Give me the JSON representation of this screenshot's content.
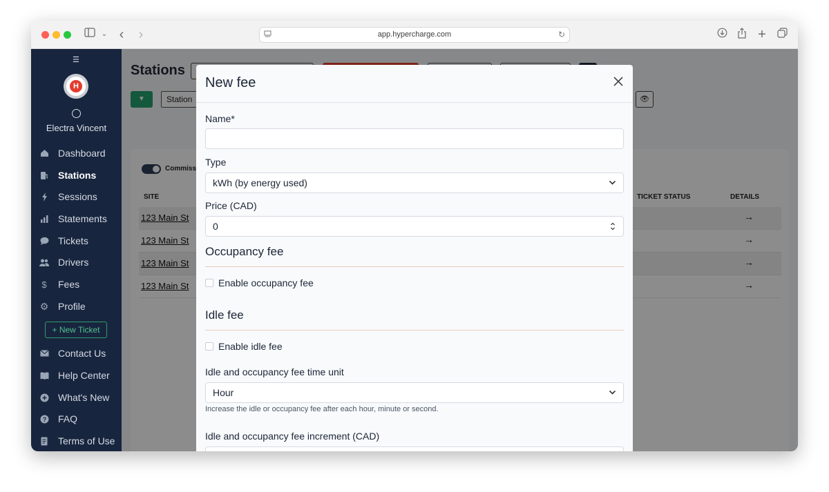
{
  "browser": {
    "url": "app.hypercharge.com"
  },
  "sidebar": {
    "user_name": "Electra Vincent",
    "logo_text": "H",
    "items": [
      {
        "label": "Dashboard",
        "icon": "home-icon"
      },
      {
        "label": "Stations",
        "icon": "charging-station-icon",
        "active": true
      },
      {
        "label": "Sessions",
        "icon": "bolt-icon"
      },
      {
        "label": "Statements",
        "icon": "bar-chart-icon"
      },
      {
        "label": "Tickets",
        "icon": "chat-bubble-icon"
      },
      {
        "label": "Drivers",
        "icon": "users-icon"
      },
      {
        "label": "Fees",
        "icon": "dollar-icon"
      },
      {
        "label": "Profile",
        "icon": "gear-icon"
      }
    ],
    "new_ticket_label": "New Ticket",
    "footer_items": [
      {
        "label": "Contact Us",
        "icon": "envelope-icon"
      },
      {
        "label": "Help Center",
        "icon": "book-icon"
      },
      {
        "label": "What's New",
        "icon": "plus-circle-icon"
      },
      {
        "label": "FAQ",
        "icon": "question-icon"
      },
      {
        "label": "Terms of Use",
        "icon": "document-icon"
      }
    ]
  },
  "page": {
    "title": "Stations",
    "station_filter": "Station",
    "toggle_label": "Commissi",
    "columns": {
      "site": "SITE",
      "ticket_status": "TICKET STATUS",
      "details": "DETAILS"
    },
    "rows": [
      {
        "site": "123 Main St"
      },
      {
        "site": "123 Main St"
      },
      {
        "site": "123 Main St"
      },
      {
        "site": "123 Main St"
      }
    ]
  },
  "modal": {
    "title": "New fee",
    "name_label": "Name*",
    "name_value": "",
    "type_label": "Type",
    "type_value": "kWh (by energy used)",
    "price_label": "Price (CAD)",
    "price_value": "0",
    "occupancy_title": "Occupancy fee",
    "occupancy_checkbox": "Enable occupancy fee",
    "idle_title": "Idle fee",
    "idle_checkbox": "Enable idle fee",
    "time_unit_label": "Idle and occupancy fee time unit",
    "time_unit_value": "Hour",
    "time_unit_help": "Increase the idle or occupancy fee after each hour, minute or second.",
    "increment_label": "Idle and occupancy fee increment (CAD)"
  }
}
